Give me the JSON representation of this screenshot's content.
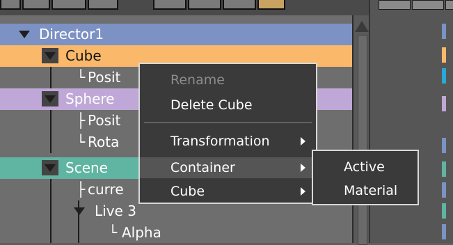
{
  "tree": {
    "rows": [
      {
        "label": "Director1",
        "color": "#7c92c4"
      },
      {
        "label": "Cube",
        "color": "#f9b86a"
      },
      {
        "label": "Posit",
        "color": ""
      },
      {
        "label": "Sphere",
        "color": "#bfa8d8"
      },
      {
        "label": "Posit",
        "color": ""
      },
      {
        "label": "Rota",
        "color": ""
      },
      {
        "label": "Scene",
        "color": "#5fb5a1"
      },
      {
        "label": "curre",
        "color": ""
      },
      {
        "label": "Live 3",
        "color": ""
      },
      {
        "label": "Alpha",
        "color": ""
      }
    ]
  },
  "context_menu": {
    "items": [
      {
        "label": "Rename",
        "enabled": false
      },
      {
        "label": "Delete Cube",
        "enabled": true
      },
      {
        "label": "Transformation",
        "submenu": true
      },
      {
        "label": "Container",
        "submenu": true,
        "highlighted": true
      },
      {
        "label": "Cube",
        "submenu": true
      }
    ]
  },
  "submenu": {
    "items": [
      {
        "label": "Active"
      },
      {
        "label": "Material"
      }
    ]
  },
  "colors": {
    "accent_orange": "#f9b86a",
    "accent_blue": "#7c92c4",
    "accent_purple": "#bfa8d8",
    "accent_teal": "#5fb5a1"
  }
}
